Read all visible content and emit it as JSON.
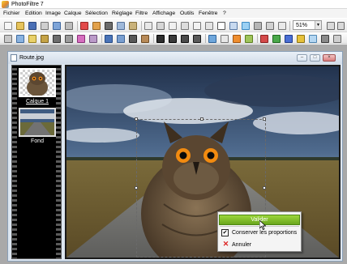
{
  "window": {
    "title": "PhotoFiltre 7"
  },
  "menubar": {
    "items": [
      {
        "label": "Fichier"
      },
      {
        "label": "Edition"
      },
      {
        "label": "Image"
      },
      {
        "label": "Calque"
      },
      {
        "label": "Sélection"
      },
      {
        "label": "Réglage"
      },
      {
        "label": "Filtre"
      },
      {
        "label": "Affichage"
      },
      {
        "label": "Outils"
      },
      {
        "label": "Fenêtre"
      },
      {
        "label": "?"
      }
    ]
  },
  "toolbar": {
    "zoom_value": "51%",
    "zoom_arrow": "▼"
  },
  "document": {
    "title": "Route.jpg",
    "buttons": {
      "minimize": "–",
      "maximize": "□",
      "close": "×"
    }
  },
  "layers": [
    {
      "label": "Calque 1",
      "selected": true
    },
    {
      "label": "Fond",
      "selected": false
    }
  ],
  "context_menu": {
    "validate": "Valider",
    "keep_proportions": "Conserver les proportions",
    "keep_proportions_checked": true,
    "check_mark": "✔",
    "cancel": "Annuler",
    "cancel_icon": "✕"
  },
  "colors": {
    "accent_green": "#7cba2a",
    "cancel_red": "#dd2222"
  }
}
